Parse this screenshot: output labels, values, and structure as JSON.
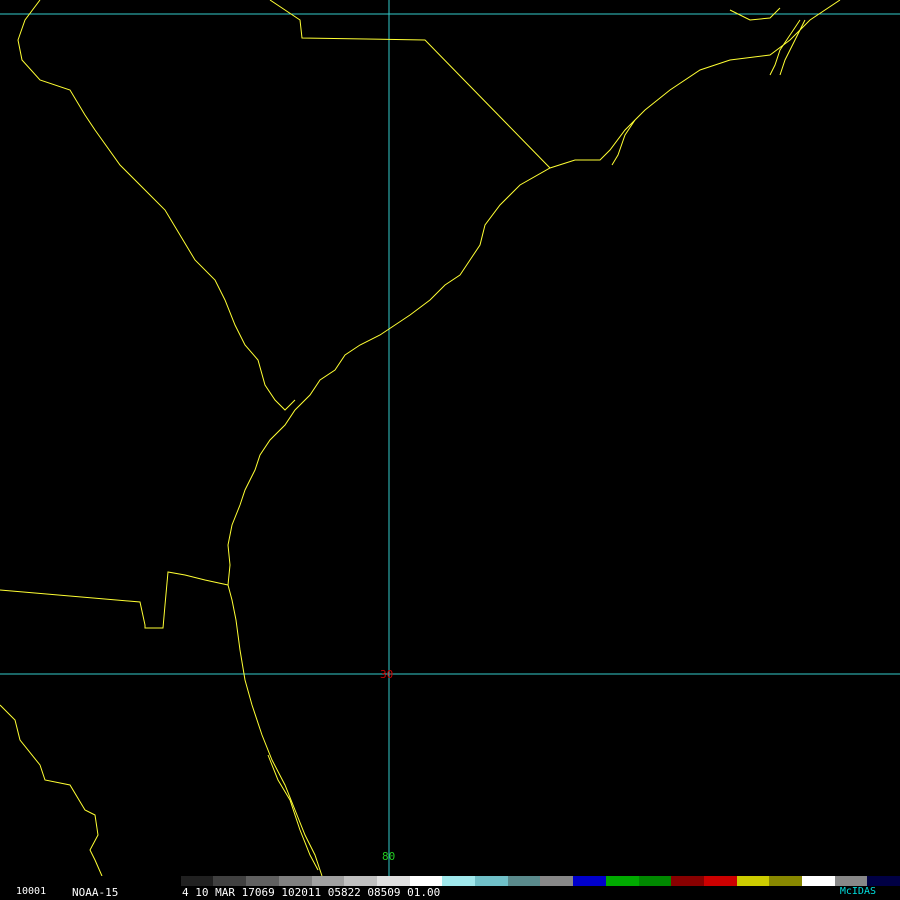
{
  "map": {
    "grid_labels": {
      "latitude": "30",
      "longitude": "80"
    },
    "colors": {
      "background": "#000000",
      "coastline": "#ffff33",
      "gridline": "#33cccc",
      "latitude_label": "#cc0000",
      "longitude_label": "#22cc22"
    }
  },
  "status_bar": {
    "frame_number": "10001",
    "satellite": "NOAA-15",
    "info": "4 10 MAR 17069 102011 05822 08509 01.00",
    "brand": "McIDAS"
  },
  "colorbar": {
    "segments": [
      "#000000",
      "#202020",
      "#404040",
      "#606060",
      "#808080",
      "#a0a0a0",
      "#c0c0c0",
      "#e0e0e0",
      "#ffffff",
      "#a0e8ec",
      "#70c0c8",
      "#5a8a8c",
      "#888888",
      "#0000cc",
      "#00aa00",
      "#008800",
      "#880000",
      "#cc0000",
      "#cccc00",
      "#888800",
      "#ffffff",
      "#888888",
      "#000044"
    ]
  }
}
